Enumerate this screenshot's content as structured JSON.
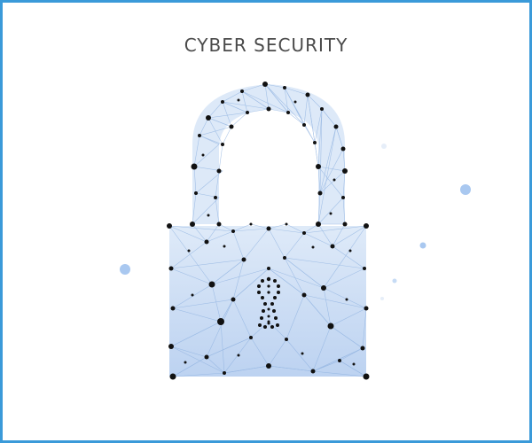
{
  "title": "CYBER SECURITY",
  "colors": {
    "frame_border": "#3a9ad9",
    "lock_fill": "#c9dcf4",
    "mesh_line": "#8fb2e0",
    "node": "#111111",
    "floating_dot": "#a9c8f0",
    "title_text": "#4a4a4a"
  },
  "illustration": {
    "name": "padlock-icon",
    "style": "low-poly network mesh"
  }
}
